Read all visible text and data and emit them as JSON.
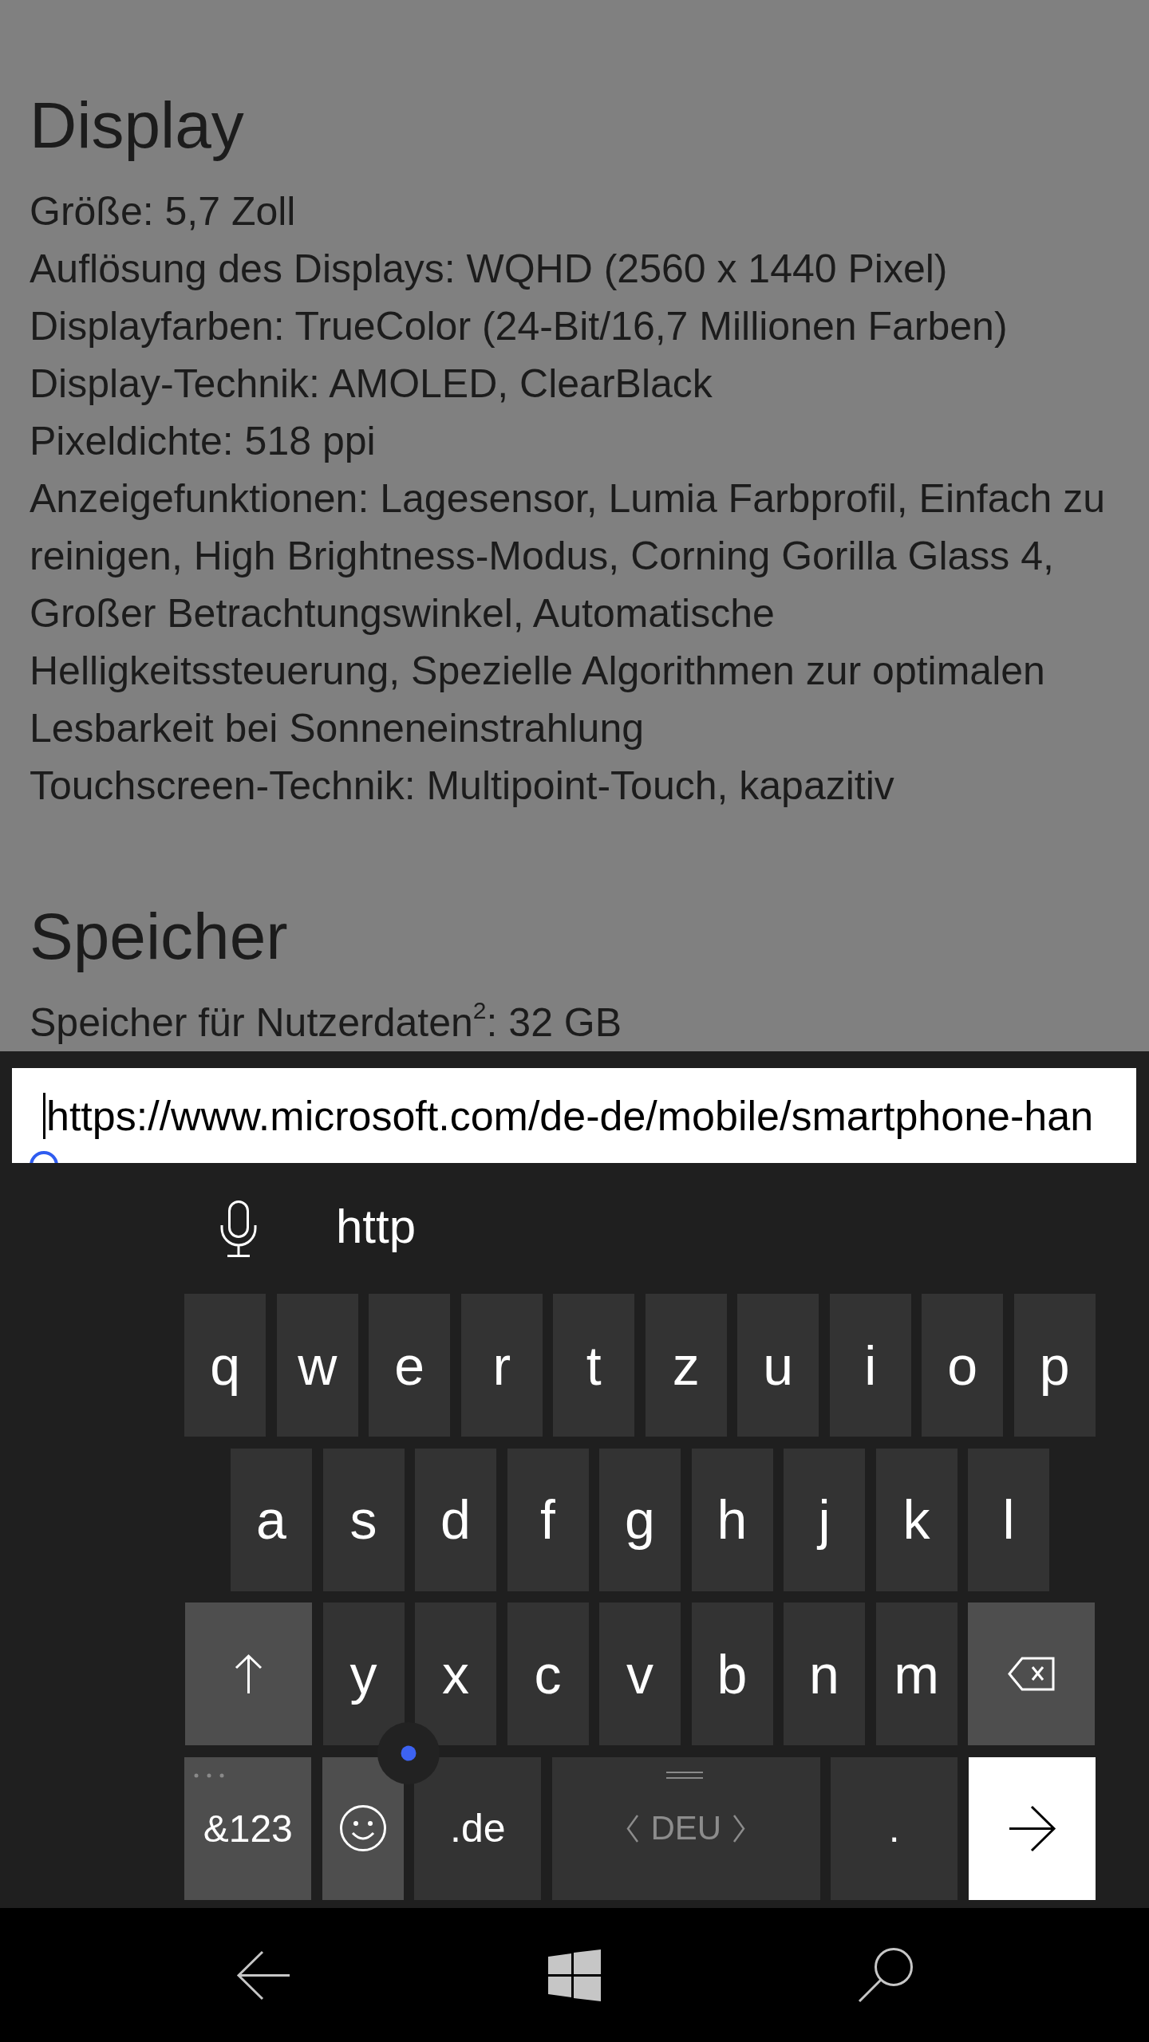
{
  "page": {
    "sections": [
      {
        "heading": "Display",
        "lines": [
          "Größe: 5,7 Zoll",
          "Auflösung des Displays: WQHD (2560 x 1440 Pixel)",
          "Displayfarben: TrueColor (24-Bit/16,7 Millionen Farben)",
          "Display-Technik: AMOLED, ClearBlack",
          "Pixeldichte: 518 ppi",
          "Anzeigefunktionen: Lagesensor, Lumia Farbprofil, Einfach zu reinigen, High Brightness-Modus, Corning Gorilla Glass 4, Großer Betrachtungswinkel, Automatische Helligkeitssteuerung, Spezielle Algorithmen zur optimalen Lesbarkeit bei Sonneneinstrahlung",
          "Touchscreen-Technik: Multipoint-Touch, kapazitiv"
        ]
      },
      {
        "heading": "Speicher",
        "lines": [
          "Speicher für Nutzerdaten$^{2}$: 32 GB"
        ]
      }
    ]
  },
  "address_bar": {
    "value": "https://www.microsoft.com/de-de/mobile/smartphone-han"
  },
  "keyboard": {
    "suggestions": [
      {
        "text": "http"
      }
    ],
    "rows": [
      {
        "keys": [
          {
            "kind": "letter",
            "label": "q"
          },
          {
            "kind": "letter",
            "label": "w"
          },
          {
            "kind": "letter",
            "label": "e"
          },
          {
            "kind": "letter",
            "label": "r"
          },
          {
            "kind": "letter",
            "label": "t"
          },
          {
            "kind": "letter",
            "label": "z"
          },
          {
            "kind": "letter",
            "label": "u"
          },
          {
            "kind": "letter",
            "label": "i"
          },
          {
            "kind": "letter",
            "label": "o"
          },
          {
            "kind": "letter",
            "label": "p"
          }
        ]
      },
      {
        "keys": [
          {
            "kind": "letter",
            "label": "a"
          },
          {
            "kind": "letter",
            "label": "s"
          },
          {
            "kind": "letter",
            "label": "d"
          },
          {
            "kind": "letter",
            "label": "f"
          },
          {
            "kind": "letter",
            "label": "g"
          },
          {
            "kind": "letter",
            "label": "h"
          },
          {
            "kind": "letter",
            "label": "j"
          },
          {
            "kind": "letter",
            "label": "k"
          },
          {
            "kind": "letter",
            "label": "l"
          }
        ]
      },
      {
        "keys": [
          {
            "kind": "shift"
          },
          {
            "kind": "letter",
            "label": "y"
          },
          {
            "kind": "letter",
            "label": "x"
          },
          {
            "kind": "letter",
            "label": "c"
          },
          {
            "kind": "letter",
            "label": "v"
          },
          {
            "kind": "letter",
            "label": "b"
          },
          {
            "kind": "letter",
            "label": "n"
          },
          {
            "kind": "letter",
            "label": "m"
          },
          {
            "kind": "backspace"
          }
        ]
      },
      {
        "keys": [
          {
            "kind": "symbols",
            "label": "&123"
          },
          {
            "kind": "emoji"
          },
          {
            "kind": "domain",
            "label": ".de"
          },
          {
            "kind": "space",
            "label": "DEU"
          },
          {
            "kind": "period",
            "label": "."
          },
          {
            "kind": "enter"
          }
        ]
      }
    ]
  },
  "nav_bar": {
    "buttons": [
      {
        "kind": "back"
      },
      {
        "kind": "start"
      },
      {
        "kind": "search"
      }
    ]
  }
}
